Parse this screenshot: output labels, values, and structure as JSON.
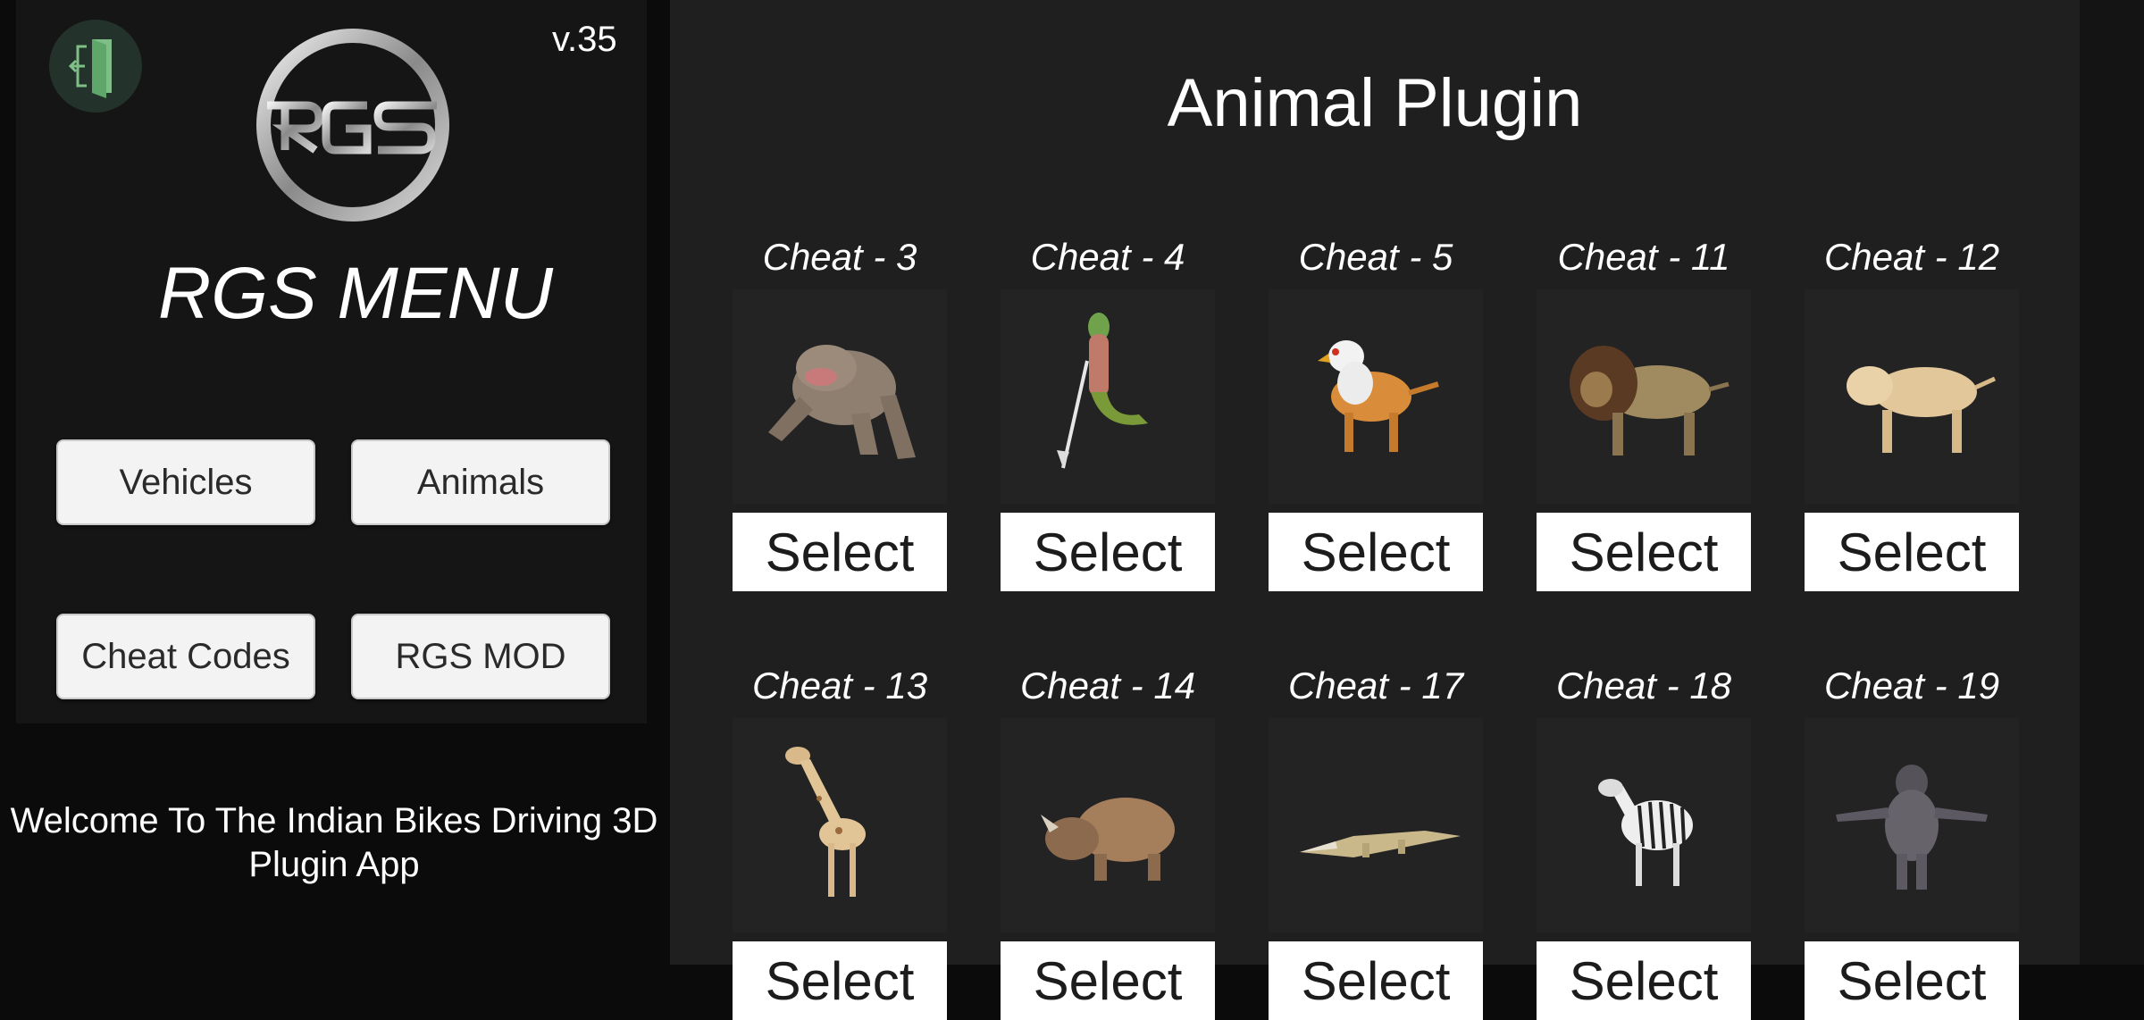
{
  "app": {
    "version": "v.35",
    "menu_title": "RGS MENU",
    "welcome_text": "Welcome To The Indian Bikes Driving 3D Plugin App"
  },
  "menu": {
    "vehicles": "Vehicles",
    "animals": "Animals",
    "cheat_codes": "Cheat Codes",
    "rgs_mod": "RGS MOD"
  },
  "plugin": {
    "title": "Animal Plugin",
    "select_label": "Select",
    "cards": [
      {
        "title": "Cheat - 3",
        "icon": "monster-icon"
      },
      {
        "title": "Cheat - 4",
        "icon": "lizard-warrior-icon"
      },
      {
        "title": "Cheat - 5",
        "icon": "griffin-icon"
      },
      {
        "title": "Cheat - 11",
        "icon": "lion-icon"
      },
      {
        "title": "Cheat - 12",
        "icon": "lioness-icon"
      },
      {
        "title": "Cheat - 13",
        "icon": "giraffe-icon"
      },
      {
        "title": "Cheat - 14",
        "icon": "rhino-icon"
      },
      {
        "title": "Cheat - 17",
        "icon": "crocodile-icon"
      },
      {
        "title": "Cheat - 18",
        "icon": "zebra-icon"
      },
      {
        "title": "Cheat - 19",
        "icon": "gorilla-icon"
      }
    ]
  },
  "colors": {
    "panel_dark": "#151515",
    "panel_right": "#1f1f1f",
    "button_bg": "#f3f3f3",
    "exit_icon": "#7fbf87"
  }
}
